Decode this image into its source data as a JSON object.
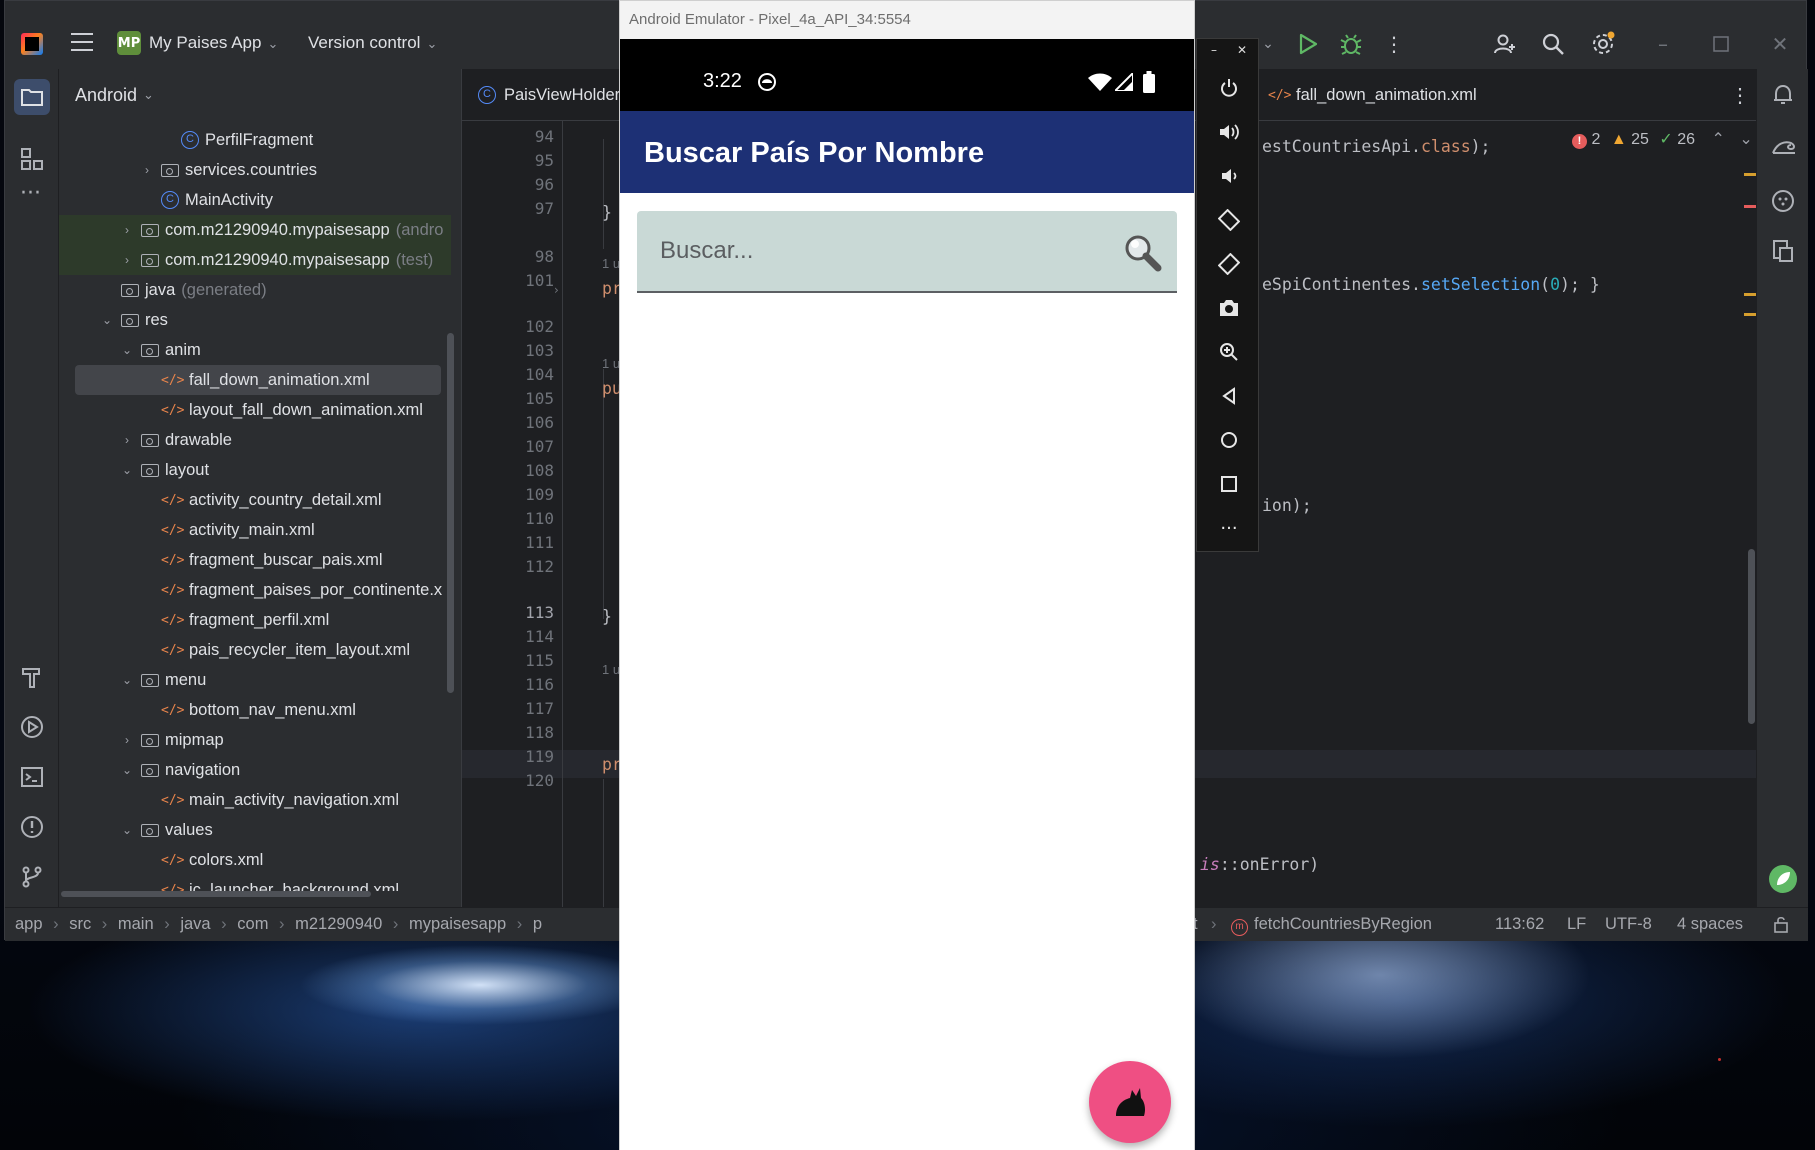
{
  "ide": {
    "project_badge": "MP",
    "project_name": "My Paises App",
    "vcs_label": "Version control",
    "project_view_label": "Android",
    "tabs": {
      "left_tab": "PaisViewHolder",
      "right_tab": "fall_down_animation.xml"
    },
    "inspections": {
      "errors": "2",
      "warnings": "25",
      "ok": "26"
    },
    "tree": [
      {
        "label": "PerfilFragment",
        "type": "class",
        "indent": 5,
        "arrow": ""
      },
      {
        "label": "services.countries",
        "type": "folder",
        "indent": 4,
        "arrow": "›"
      },
      {
        "label": "MainActivity",
        "type": "class",
        "indent": 4,
        "arrow": ""
      },
      {
        "label": "com.m21290940.mypaisesapp",
        "suffix": "(andro",
        "type": "folder",
        "indent": 3,
        "arrow": "›",
        "green": true
      },
      {
        "label": "com.m21290940.mypaisesapp",
        "suffix": "(test)",
        "type": "folder",
        "indent": 3,
        "arrow": "›",
        "green": true
      },
      {
        "label": "java",
        "suffix": "(generated)",
        "type": "folder",
        "indent": 2,
        "arrow": ""
      },
      {
        "label": "res",
        "type": "folder",
        "indent": 2,
        "arrow": "⌄"
      },
      {
        "label": "anim",
        "type": "folder",
        "indent": 3,
        "arrow": "⌄"
      },
      {
        "label": "fall_down_animation.xml",
        "type": "xml",
        "indent": 4,
        "arrow": "",
        "selected": true
      },
      {
        "label": "layout_fall_down_animation.xml",
        "type": "xml",
        "indent": 4,
        "arrow": ""
      },
      {
        "label": "drawable",
        "type": "folder",
        "indent": 3,
        "arrow": "›"
      },
      {
        "label": "layout",
        "type": "folder",
        "indent": 3,
        "arrow": "⌄"
      },
      {
        "label": "activity_country_detail.xml",
        "type": "xml",
        "indent": 4,
        "arrow": ""
      },
      {
        "label": "activity_main.xml",
        "type": "xml",
        "indent": 4,
        "arrow": ""
      },
      {
        "label": "fragment_buscar_pais.xml",
        "type": "xml",
        "indent": 4,
        "arrow": ""
      },
      {
        "label": "fragment_paises_por_continente.x",
        "type": "xml",
        "indent": 4,
        "arrow": ""
      },
      {
        "label": "fragment_perfil.xml",
        "type": "xml",
        "indent": 4,
        "arrow": ""
      },
      {
        "label": "pais_recycler_item_layout.xml",
        "type": "xml",
        "indent": 4,
        "arrow": ""
      },
      {
        "label": "menu",
        "type": "folder",
        "indent": 3,
        "arrow": "⌄"
      },
      {
        "label": "bottom_nav_menu.xml",
        "type": "xml",
        "indent": 4,
        "arrow": ""
      },
      {
        "label": "mipmap",
        "type": "folder",
        "indent": 3,
        "arrow": "›"
      },
      {
        "label": "navigation",
        "type": "folder",
        "indent": 3,
        "arrow": "⌄"
      },
      {
        "label": "main_activity_navigation.xml",
        "type": "xml",
        "indent": 4,
        "arrow": ""
      },
      {
        "label": "values",
        "type": "folder",
        "indent": 3,
        "arrow": "⌄"
      },
      {
        "label": "colors.xml",
        "type": "xml",
        "indent": 4,
        "arrow": ""
      },
      {
        "label": "ic_launcher_background.xml",
        "type": "xml",
        "indent": 4,
        "arrow": ""
      }
    ],
    "line_numbers": [
      "94",
      "95",
      "96",
      "97",
      "98",
      "101",
      "102",
      "103",
      "104",
      "105",
      "106",
      "107",
      "108",
      "109",
      "110",
      "111",
      "112",
      "113",
      "114",
      "115",
      "116",
      "117",
      "118",
      "119",
      "120"
    ],
    "current_line": "113",
    "code": {
      "l1": "estCountriesApi.",
      "l1_kw": "class",
      "l1_end": ");",
      "l2": "eSpiContinentes.",
      "l2_fn": "setSelection",
      "l2_open": "(",
      "l2_num": "0",
      "l2_end": "); }",
      "l3": "ion);",
      "l4_purple": "is",
      "l4_rest": "::onError)",
      "brace1": "}",
      "brace2": "}",
      "frag_pr": "pr",
      "frag_pu": "pu",
      "frag_pr2": "pr",
      "usage_hint": "1 u"
    },
    "statusbar": {
      "crumbs": [
        "app",
        "src",
        "main",
        "java",
        "com",
        "m21290940",
        "mypaisesapp",
        "p"
      ],
      "t_fragment": "t",
      "method": "fetchCountriesByRegion",
      "position": "113:62",
      "line_sep": "LF",
      "encoding": "UTF-8",
      "indent": "4 spaces"
    }
  },
  "emulator": {
    "window_title": "Android Emulator - Pixel_4a_API_34:5554",
    "status_time": "3:22",
    "app_title": "Buscar País Por Nombre",
    "search": {
      "placeholder": "Buscar...",
      "value": ""
    },
    "side_buttons": [
      "power",
      "volume-up",
      "volume-down",
      "rotate-left",
      "rotate-right",
      "camera",
      "zoom",
      "back",
      "home",
      "overview",
      "more"
    ]
  },
  "colors": {
    "appbar": "#1d3075",
    "search_field": "#c9d9d6",
    "fab": "#ef4f83",
    "ide_bg": "#1e1f22"
  }
}
